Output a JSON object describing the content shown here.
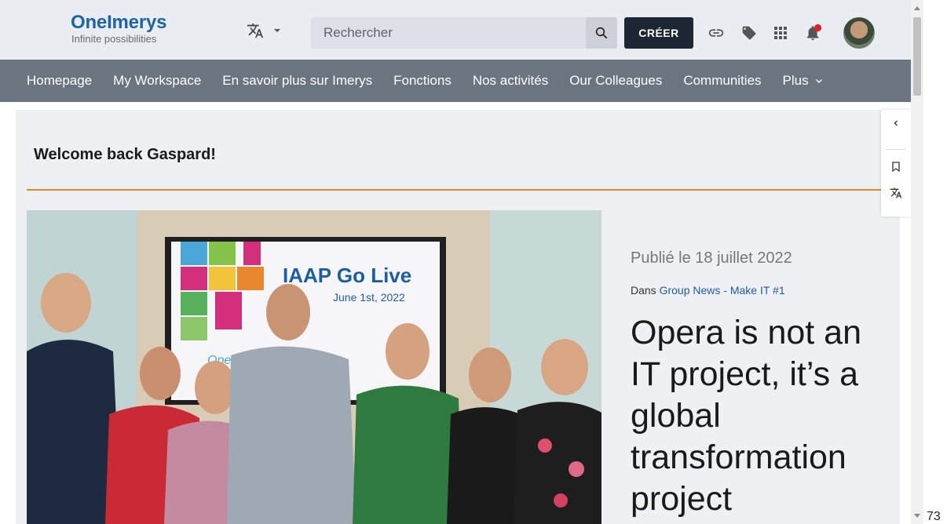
{
  "header": {
    "logo": {
      "name_part1": "One",
      "name_part2": "Imerys",
      "tagline": "Infinite possibilities"
    },
    "language_icon": "translate-icon",
    "search": {
      "placeholder": "Rechercher"
    },
    "create_label": "CRÉER",
    "icons": [
      "link-icon",
      "tag-icon",
      "apps-grid-icon",
      "bell-icon",
      "avatar"
    ]
  },
  "nav": {
    "items": [
      {
        "label": "Homepage"
      },
      {
        "label": "My Workspace"
      },
      {
        "label": "En savoir plus sur Imerys"
      },
      {
        "label": "Fonctions"
      },
      {
        "label": "Nos activités"
      },
      {
        "label": "Our Colleagues"
      },
      {
        "label": "Communities"
      },
      {
        "label": "Plus"
      }
    ]
  },
  "main": {
    "welcome": "Welcome back Gaspard!",
    "article": {
      "published": "Publié le 18 juillet 2022",
      "category_prefix": "Dans",
      "category": "Group News - Make IT #1",
      "title": "Opera is not an IT project, it’s a global transformation project",
      "image_text": {
        "headline": "IAAP Go Live",
        "date": "June 1st, 2022",
        "brand": "Opera"
      }
    }
  },
  "page_number": "73",
  "colors": {
    "accent": "#e8872e",
    "brand": "#1d64a4",
    "nav_bg": "#6a7580",
    "create_bg": "#1c2733",
    "notification": "#e0202c"
  }
}
